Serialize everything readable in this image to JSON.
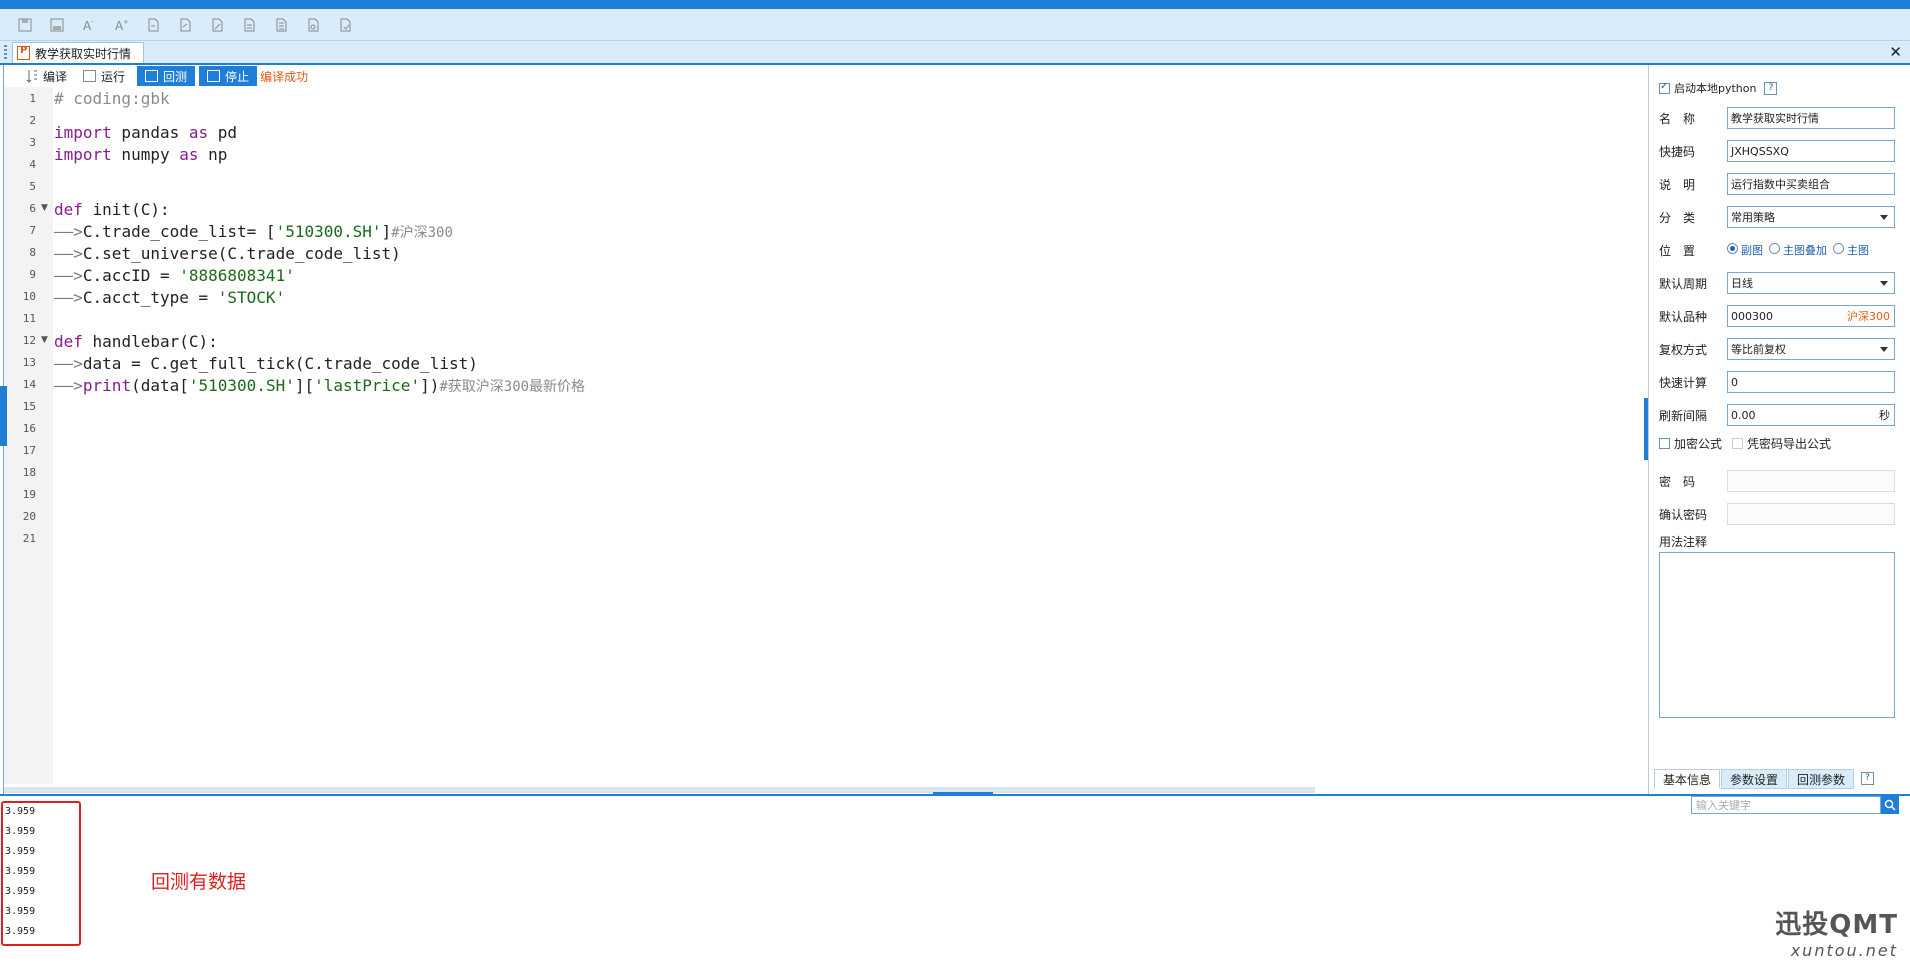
{
  "toolbar": {
    "icons": [
      "save-icon",
      "save-as-icon",
      "font-decrease-icon",
      "font-increase-icon",
      "import-icon",
      "export-icon",
      "edit-doc-icon",
      "doc-icon",
      "doc-list-icon",
      "doc-image-icon",
      "doc-settings-icon"
    ]
  },
  "tab": {
    "title": "教学获取实时行情",
    "close": "✕"
  },
  "actions": {
    "compile": "编译",
    "run": "运行",
    "backtest": "回测",
    "stop": "停止",
    "status": "编译成功"
  },
  "editor": {
    "line_numbers": [
      "1",
      "2",
      "3",
      "4",
      "5",
      "6",
      "7",
      "8",
      "9",
      "10",
      "11",
      "12",
      "13",
      "14",
      "15",
      "16",
      "17",
      "18",
      "19",
      "20",
      "21"
    ],
    "lines": {
      "l1": "# coding:gbk",
      "l3_kw": "import",
      "l3_mod": " pandas ",
      "l3_as": "as",
      "l3_alias": " pd",
      "l4_kw": "import",
      "l4_mod": " numpy ",
      "l4_as": "as",
      "l4_alias": " np",
      "l7_kw": "def",
      "l7_rest": " init(C):",
      "l8_code": "C.trade_code_list= [",
      "l8_str": "'510300.SH'",
      "l8_end": "]",
      "l8_cmt": "#沪深300",
      "l9_code": "C.set_universe(C.trade_code_list)",
      "l10_code": "C.accID = ",
      "l10_str": "'8886808341'",
      "l11_code": "C.acct_type = ",
      "l11_str": "'STOCK'",
      "l13_kw": "def",
      "l13_rest": " handlebar(C):",
      "l14_code": "data = C.get_full_tick(C.trade_code_list)",
      "l15_kw": "print",
      "l15_code": "(data[",
      "l15_str1": "'510300.SH'",
      "l15_mid": "][",
      "l15_str2": "'lastPrice'",
      "l15_end": "])",
      "l15_cmt": "#获取沪深300最新价格",
      "arrow": "——>"
    }
  },
  "settings": {
    "local_python_label": "启动本地python",
    "help": "?",
    "name_label": "名　称",
    "name_value": "教学获取实时行情",
    "shortcut_label": "快捷码",
    "shortcut_value": "JXHQSSXQ",
    "desc_label": "说　明",
    "desc_value": "运行指数中买卖组合",
    "category_label": "分　类",
    "category_value": "常用策略",
    "position_label": "位　置",
    "position_options": [
      "副图",
      "主图叠加",
      "主图"
    ],
    "period_label": "默认周期",
    "period_value": "日线",
    "symbol_label": "默认品种",
    "symbol_value": "000300",
    "symbol_name": "沪深300",
    "adjust_label": "复权方式",
    "adjust_value": "等比前复权",
    "fast_calc_label": "快速计算",
    "fast_calc_value": "0",
    "refresh_label": "刷新间隔",
    "refresh_value": "0.00",
    "refresh_unit": "秒",
    "encrypt_label": "加密公式",
    "export_label": "凭密码导出公式",
    "password_label": "密　码",
    "confirm_label": "确认密码",
    "notes_label": "用法注释",
    "tabs": [
      "基本信息",
      "参数设置",
      "回测参数"
    ]
  },
  "output": {
    "lines": [
      "3.959",
      "3.959",
      "3.959",
      "3.959",
      "3.959",
      "3.959",
      "3.959"
    ],
    "annotation": "回测有数据",
    "search_placeholder": "输入关键字"
  },
  "watermark": {
    "logo": "迅投QMT",
    "url": "xuntou.net"
  },
  "colors": {
    "accent": "#1f7fd8",
    "annotation_red": "#e02020",
    "status_orange": "#e05a10"
  }
}
